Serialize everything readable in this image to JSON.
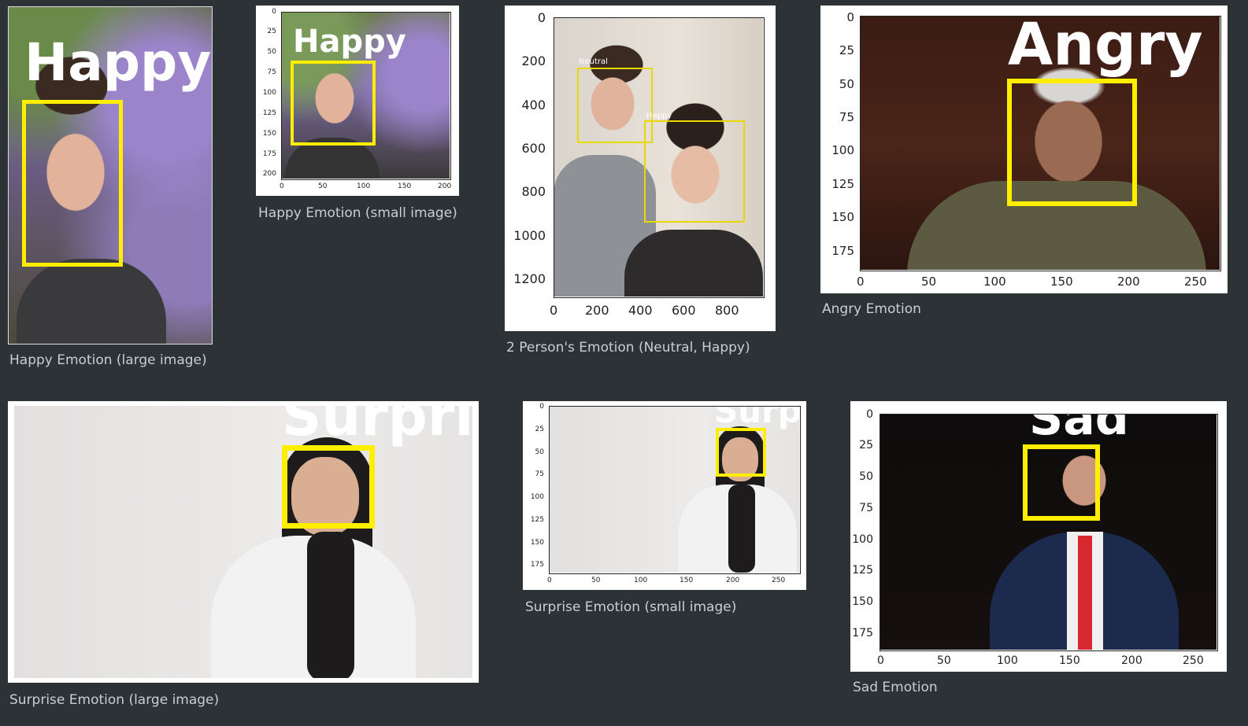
{
  "figures": [
    {
      "caption": "Happy Emotion (large image)",
      "emotion_label": "Happy",
      "axes_shown": false
    },
    {
      "caption": "Happy Emotion (small image)",
      "emotion_label": "Happy",
      "axes_shown": true,
      "x_ticks": [
        "0",
        "50",
        "100",
        "150",
        "200"
      ],
      "y_ticks": [
        "0",
        "25",
        "50",
        "75",
        "100",
        "125",
        "150",
        "175",
        "200"
      ]
    },
    {
      "caption": "2 Person's Emotion (Neutral, Happy)",
      "emotion_labels": [
        "Neutral",
        "Happy"
      ],
      "axes_shown": true,
      "x_ticks": [
        "0",
        "200",
        "400",
        "600",
        "800"
      ],
      "y_ticks": [
        "0",
        "200",
        "400",
        "600",
        "800",
        "1000",
        "1200"
      ]
    },
    {
      "caption": "Angry Emotion",
      "emotion_label": "Angry",
      "axes_shown": true,
      "x_ticks": [
        "0",
        "50",
        "100",
        "150",
        "200",
        "250"
      ],
      "y_ticks": [
        "0",
        "25",
        "50",
        "75",
        "100",
        "125",
        "150",
        "175"
      ]
    },
    {
      "caption": "Surprise Emotion (large image)",
      "emotion_label": "Surpri",
      "axes_shown": false
    },
    {
      "caption": "Surprise Emotion (small image)",
      "emotion_label": "Surpr",
      "axes_shown": true,
      "x_ticks": [
        "0",
        "50",
        "100",
        "150",
        "200",
        "250"
      ],
      "y_ticks": [
        "0",
        "25",
        "50",
        "75",
        "100",
        "125",
        "150",
        "175"
      ]
    },
    {
      "caption": "Sad Emotion",
      "emotion_label": "Sad",
      "axes_shown": true,
      "x_ticks": [
        "0",
        "50",
        "100",
        "150",
        "200",
        "250"
      ],
      "y_ticks": [
        "0",
        "25",
        "50",
        "75",
        "100",
        "125",
        "150",
        "175"
      ]
    }
  ],
  "colors": {
    "page_background": "#2d3236",
    "caption_text": "#c9ced2",
    "detection_box": "#ffee00",
    "label_text": "#ffffff"
  }
}
